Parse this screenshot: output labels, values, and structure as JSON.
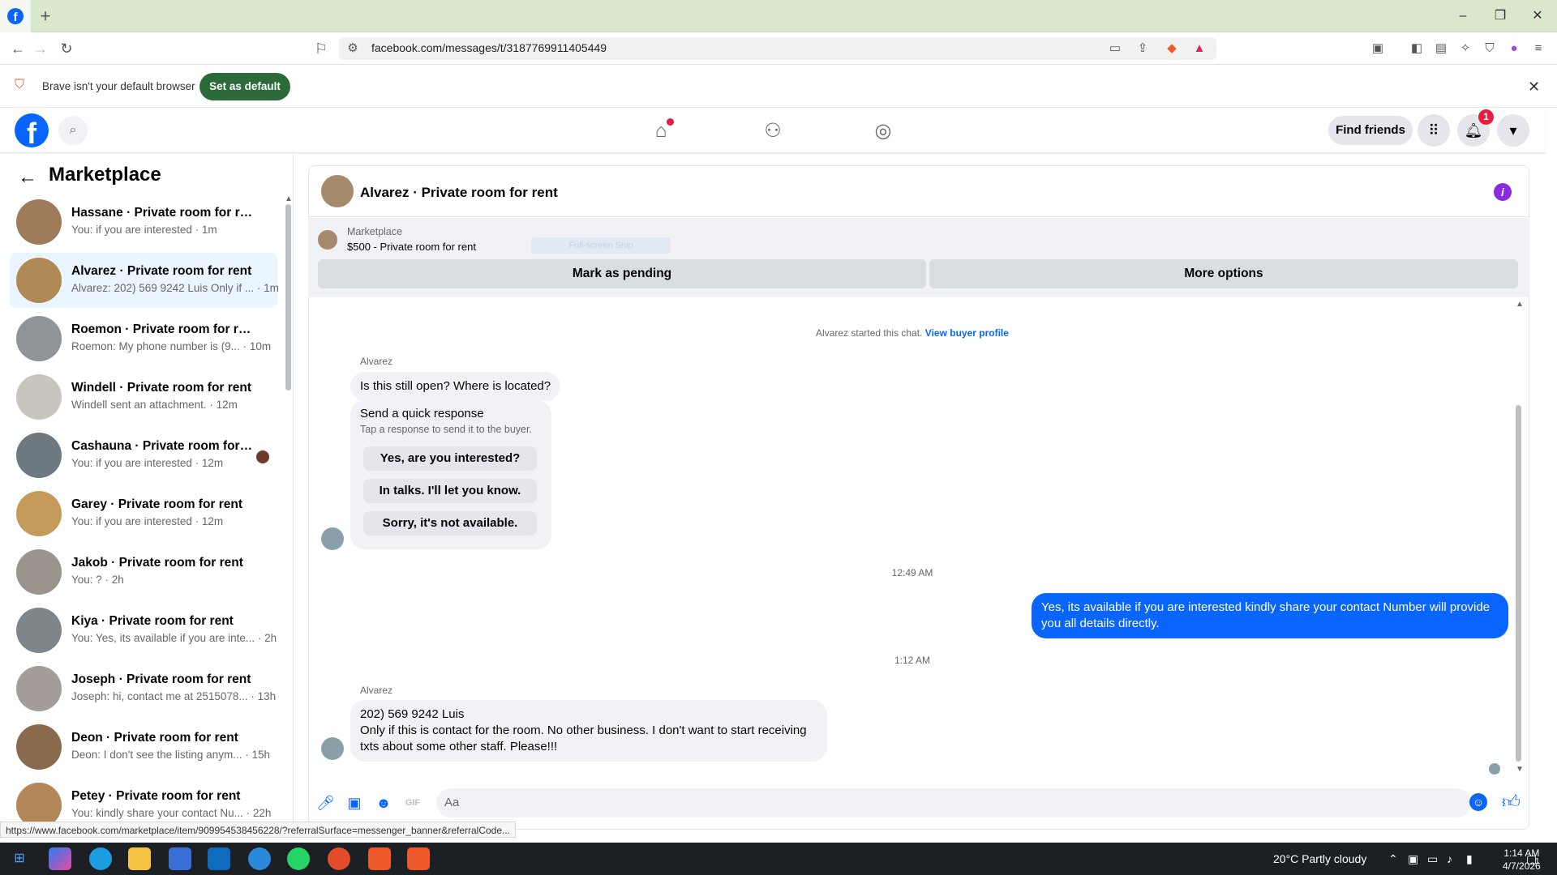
{
  "browser": {
    "tab_icon": "facebook-icon",
    "new_tab": "+",
    "url": "facebook.com/messages/t/3187769911405449",
    "infobar_text": "Brave isn't your default browser",
    "set_default": "Set as default",
    "status_url": "https://www.facebook.com/marketplace/item/909954538456228/?referralSurface=messenger_banner&referralCode..."
  },
  "header": {
    "find_friends": "Find friends",
    "notification_count": "1"
  },
  "sidebar": {
    "title": "Marketplace",
    "conversations": [
      {
        "name": "Hassane · Private room for rent",
        "preview": "You: if you are interested · 1m"
      },
      {
        "name": "Alvarez · Private room for rent",
        "preview": "Alvarez: 202) 569 9242 Luis Only if ... · 1m"
      },
      {
        "name": "Roemon · Private room for rent",
        "preview": "Roemon: My phone number is (9... · 10m"
      },
      {
        "name": "Windell · Private room for rent",
        "preview": "Windell sent an attachment. · 12m"
      },
      {
        "name": "Cashauna · Private room for r...",
        "preview": "You: if you are interested · 12m"
      },
      {
        "name": "Garey · Private room for rent",
        "preview": "You: if you are interested · 12m"
      },
      {
        "name": "Jakob · Private room for rent",
        "preview": "You: ? · 2h"
      },
      {
        "name": "Kiya · Private room for rent",
        "preview": "You: Yes, its available if you are inte... · 2h"
      },
      {
        "name": "Joseph · Private room for rent",
        "preview": "Joseph: hi, contact me at 2515078... · 13h"
      },
      {
        "name": "Deon · Private room for rent",
        "preview": "Deon: I don't see the listing anym... · 15h"
      },
      {
        "name": "Petey · Private room for rent",
        "preview": "You: kindly share your contact Nu... · 22h"
      }
    ]
  },
  "chat": {
    "title": "Alvarez · Private room for rent",
    "listing_category": "Marketplace",
    "listing_title": "$500 - Private room for rent",
    "ghost_text": "Full-screen Snip",
    "mark_pending": "Mark as pending",
    "more_options": "More options",
    "started_text": "Alvarez started this chat.",
    "view_profile": "View buyer profile",
    "sender_1": "Alvarez",
    "msg_1": "Is this still open? Where is located?",
    "quick_title": "Send a quick response",
    "quick_sub": "Tap a response to send it to the buyer.",
    "quick_1": "Yes, are you interested?",
    "quick_2": "In talks. I'll let you know.",
    "quick_3": "Sorry, it's not available.",
    "time_1": "12:49 AM",
    "msg_out": "Yes, its available if you are interested kindly share your contact Number will provide you all details directly.",
    "time_2": "1:12 AM",
    "sender_2": "Alvarez",
    "msg_2_line1": "202) 569 9242 Luis",
    "msg_2_line2": "Only if this is contact for the room. No other business. I don't want to start receiving txts about some other staff. Please!!!",
    "composer_placeholder": "Aa"
  },
  "taskbar": {
    "weather": "20°C  Partly cloudy",
    "time": "1:14 AM",
    "date": "4/7/2026",
    "notif": "1"
  },
  "colors": {
    "fb_blue": "#0866ff",
    "brave_green": "#2d6a3a",
    "tab_green": "#d9e7cc"
  }
}
